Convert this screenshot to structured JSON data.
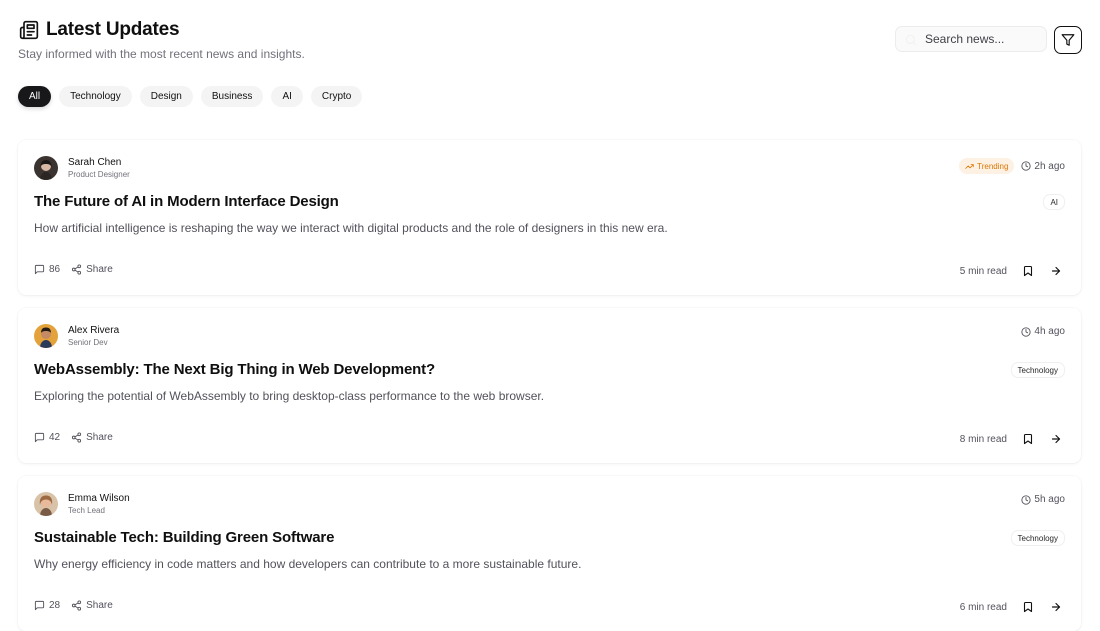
{
  "header": {
    "title": "Latest Updates",
    "subtitle": "Stay informed with the most recent news and insights."
  },
  "search": {
    "placeholder": "Search news..."
  },
  "tabs": [
    {
      "label": "All",
      "active": true
    },
    {
      "label": "Technology",
      "active": false
    },
    {
      "label": "Design",
      "active": false
    },
    {
      "label": "Business",
      "active": false
    },
    {
      "label": "AI",
      "active": false
    },
    {
      "label": "Crypto",
      "active": false
    }
  ],
  "articles": [
    {
      "author": "Sarah Chen",
      "role": "Product Designer",
      "trending": true,
      "trending_label": "Trending",
      "time": "2h ago",
      "title": "The Future of AI in Modern Interface Design",
      "category": "AI",
      "description": "How artificial intelligence is reshaping the way we interact with digital products and the role of designers in this new era.",
      "comments": "86",
      "share_label": "Share",
      "read_time": "5 min read"
    },
    {
      "author": "Alex Rivera",
      "role": "Senior Dev",
      "trending": false,
      "time": "4h ago",
      "title": "WebAssembly: The Next Big Thing in Web Development?",
      "category": "Technology",
      "description": "Exploring the potential of WebAssembly to bring desktop-class performance to the web browser.",
      "comments": "42",
      "share_label": "Share",
      "read_time": "8 min read"
    },
    {
      "author": "Emma Wilson",
      "role": "Tech Lead",
      "trending": false,
      "time": "5h ago",
      "title": "Sustainable Tech: Building Green Software",
      "category": "Technology",
      "description": "Why energy efficiency in code matters and how developers can contribute to a more sustainable future.",
      "comments": "28",
      "share_label": "Share",
      "read_time": "6 min read"
    }
  ],
  "colors": {
    "active_tab": "#18181b",
    "tab_bg": "#f4f4f5",
    "trending_bg": "#fdf1e4",
    "trending_text": "#d97706",
    "muted_text": "#71717a"
  },
  "icons": {
    "title": "newspaper-icon",
    "search": "search-icon",
    "filter": "filter-icon",
    "trending": "trending-up-icon",
    "time": "clock-icon",
    "comments": "message-square-icon",
    "share": "share-icon",
    "bookmark": "bookmark-icon",
    "open": "arrow-right-icon"
  }
}
